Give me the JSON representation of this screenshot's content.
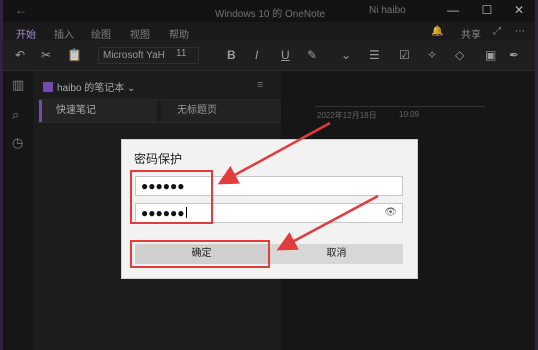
{
  "titlebar": {
    "back_glyph": "←",
    "title": "Windows 10 的 OneNote",
    "user": "Ni haibo",
    "min_glyph": "—",
    "max_glyph": "☐",
    "close_glyph": "✕"
  },
  "ribbon": {
    "tabs": [
      "开始",
      "插入",
      "绘图",
      "视图",
      "帮助"
    ],
    "share_label": "共享"
  },
  "toolbar": {
    "font_name": "Microsoft YaH",
    "font_size": "11",
    "bold": "B",
    "italic": "I",
    "underline": "U"
  },
  "notebook": {
    "name": "haibo 的笔记本",
    "chevron": "⌄",
    "sections": [
      "快速笔记",
      "无标题页"
    ]
  },
  "page": {
    "date": "2022年12月18日",
    "time": "10:09"
  },
  "dialog": {
    "title": "密码保护",
    "password_value": "●●●●●●",
    "confirm_value": "●●●●●●",
    "ok_label": "确定",
    "cancel_label": "取消"
  },
  "colors": {
    "accent": "#8b5fd6",
    "highlight": "#e23c3c"
  }
}
